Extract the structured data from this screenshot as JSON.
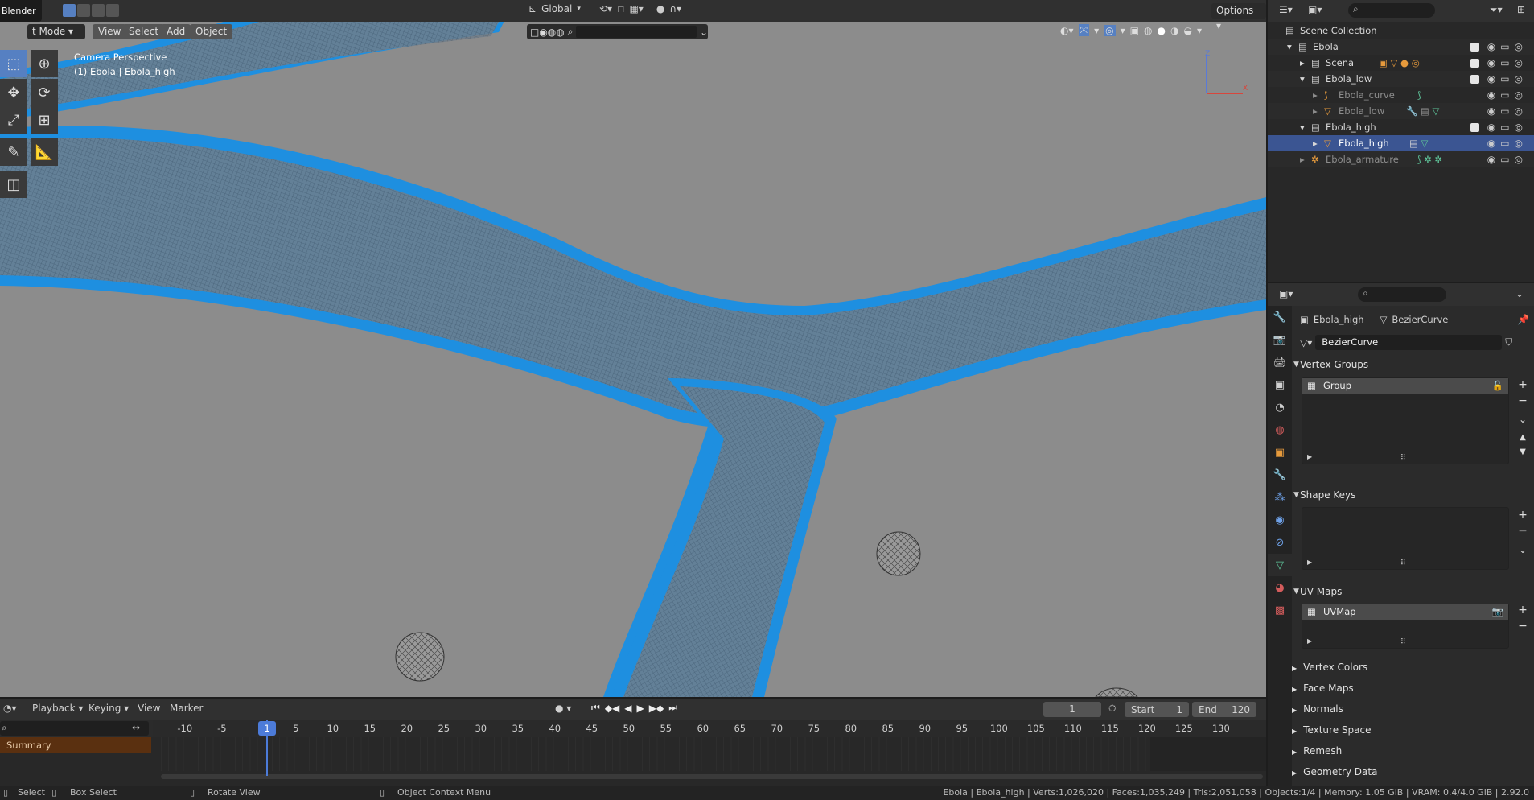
{
  "app": {
    "name": "Blender"
  },
  "viewport": {
    "mode": "Object Mode",
    "mode_visible": "t Mode",
    "menus": [
      "View",
      "Select",
      "Add",
      "Object"
    ],
    "orientation": "Global",
    "options": "Options",
    "overlay_line1": "Camera Perspective",
    "overlay_line2": "(1) Ebola | Ebola_high",
    "axis_z": "Z",
    "axis_x": "X"
  },
  "outliner": {
    "rows": [
      {
        "label": "Scene Collection"
      },
      {
        "label": "Ebola"
      },
      {
        "label": "Scena"
      },
      {
        "label": "Ebola_low"
      },
      {
        "label": "Ebola_curve"
      },
      {
        "label": "Ebola_low"
      },
      {
        "label": "Ebola_high"
      },
      {
        "label": "Ebola_high"
      },
      {
        "label": "Ebola_armature"
      }
    ]
  },
  "properties": {
    "breadcrumb_object": "Ebola_high",
    "breadcrumb_data": "BezierCurve",
    "datablock_name": "BezierCurve",
    "sections": {
      "vertex_groups": "Vertex Groups",
      "shape_keys": "Shape Keys",
      "uv_maps": "UV Maps"
    },
    "vertex_group_item": "Group",
    "uv_map_item": "UVMap",
    "collapsed": [
      "Vertex Colors",
      "Face Maps",
      "Normals",
      "Texture Space",
      "Remesh",
      "Geometry Data"
    ]
  },
  "timeline": {
    "menus": [
      "Playback",
      "Keying",
      "View",
      "Marker"
    ],
    "current_frame": "1",
    "start_label": "Start",
    "start_value": "1",
    "end_label": "End",
    "end_value": "120",
    "playhead": "1",
    "ticks": [
      "-10",
      "-5",
      "5",
      "10",
      "15",
      "20",
      "25",
      "30",
      "35",
      "40",
      "45",
      "50",
      "55",
      "60",
      "65",
      "70",
      "75",
      "80",
      "85",
      "90",
      "95",
      "100",
      "105",
      "110",
      "115",
      "120",
      "125",
      "130"
    ],
    "summary": "Summary"
  },
  "statusbar": {
    "select": "Select",
    "box_select": "Box Select",
    "rotate_view": "Rotate View",
    "context_menu": "Object Context Menu",
    "stats": "Ebola | Ebola_high | Verts:1,026,020 | Faces:1,035,249 | Tris:2,051,058 | Objects:1/4 | Memory: 1.05 GiB | VRAM: 0.4/4.0 GiB | 2.92.0"
  },
  "colors": {
    "accent": "#4c7bd8",
    "mesh": "#1e8fe0",
    "viewport_bg": "#8c8c8c"
  }
}
